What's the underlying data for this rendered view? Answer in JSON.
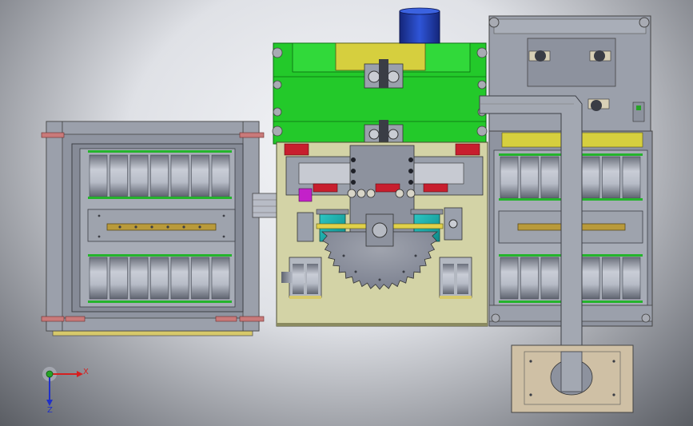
{
  "triad": {
    "x_label": "X",
    "z_label": "Z",
    "x_color": "#d62020",
    "y_color": "#27a327",
    "z_color": "#2030c8"
  },
  "colors": {
    "frame": "#8a8f9c",
    "frame_dark": "#5b5f6b",
    "plate_olive": "#d3d3a6",
    "plate_green": "#23c92a",
    "plate_green_dark": "#119e19",
    "motor_blue": "#2140c0",
    "accent_red": "#c81e2e",
    "accent_teal": "#16a7a7",
    "accent_magenta": "#c321c9",
    "brass": "#b99a3a",
    "roller": "#9aa0ad",
    "base_tan": "#cfc0a5"
  }
}
